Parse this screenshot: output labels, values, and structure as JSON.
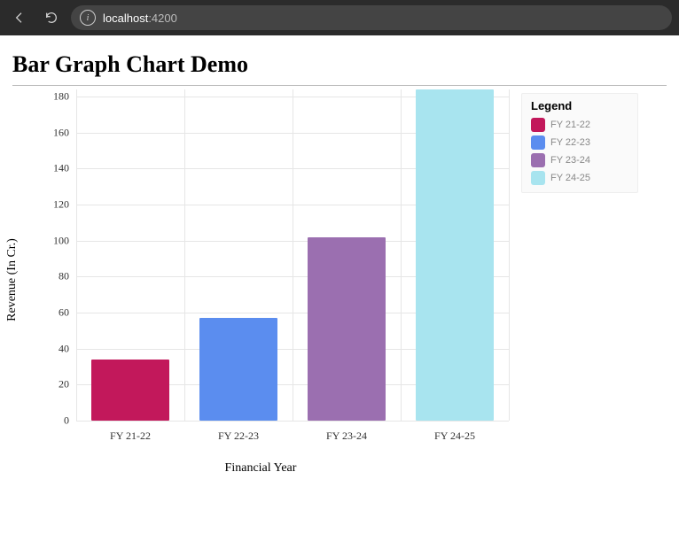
{
  "browser": {
    "host": "localhost",
    "port": ":4200"
  },
  "page": {
    "title": "Bar Graph Chart Demo"
  },
  "legend": {
    "title": "Legend",
    "items": [
      {
        "label": "FY 21-22",
        "color": "#c2185b"
      },
      {
        "label": "FY 22-23",
        "color": "#5b8def"
      },
      {
        "label": "FY 23-24",
        "color": "#9b6fb0"
      },
      {
        "label": "FY 24-25",
        "color": "#a8e4ef"
      }
    ]
  },
  "chart_data": {
    "type": "bar",
    "categories": [
      "FY 21-22",
      "FY 22-23",
      "FY 23-24",
      "FY 24-25"
    ],
    "values": [
      34,
      57,
      102,
      184
    ],
    "colors": [
      "#c2185b",
      "#5b8def",
      "#9b6fb0",
      "#a8e4ef"
    ],
    "title": "",
    "xlabel": "Financial Year",
    "ylabel": "Revenue (In Cr.)",
    "ylim": [
      0,
      184
    ],
    "yticks": [
      0,
      20,
      40,
      60,
      80,
      100,
      120,
      140,
      160,
      180
    ]
  }
}
